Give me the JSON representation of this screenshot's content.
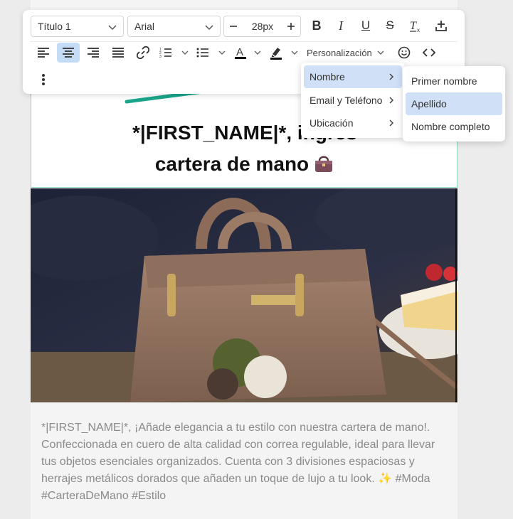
{
  "toolbar": {
    "heading_select": "Título 1",
    "font_select": "Arial",
    "font_size": "28px",
    "personalization_label": "Personalización"
  },
  "menu_main": {
    "items": [
      {
        "label": "Nombre"
      },
      {
        "label": "Email y Teléfono"
      },
      {
        "label": "Ubicación"
      }
    ]
  },
  "menu_sub": {
    "items": [
      {
        "label": "Primer nombre"
      },
      {
        "label": "Apellido"
      },
      {
        "label": "Nombre completo"
      }
    ]
  },
  "email": {
    "headline_line1": "*|FIRST_NAME|*, ingres",
    "headline_line2": "cartera de mano",
    "body_text": "*|FIRST_NAME|*, ¡Añade elegancia a tu estilo con nuestra cartera de mano!. Confeccionada en cuero de alta calidad con correa regulable, ideal para llevar tus objetos esenciales organizados. Cuenta con 3 divisiones espaciosas y herrajes metálicos dorados que añaden un toque de lujo a tu look.",
    "body_tags": "#Moda #CarteraDeMano #Estilo"
  },
  "colors": {
    "accent": "#1aa58a",
    "highlight": "#cfe0f7",
    "active_button": "#c5dcf7",
    "body_text": "#8a8a8a"
  }
}
